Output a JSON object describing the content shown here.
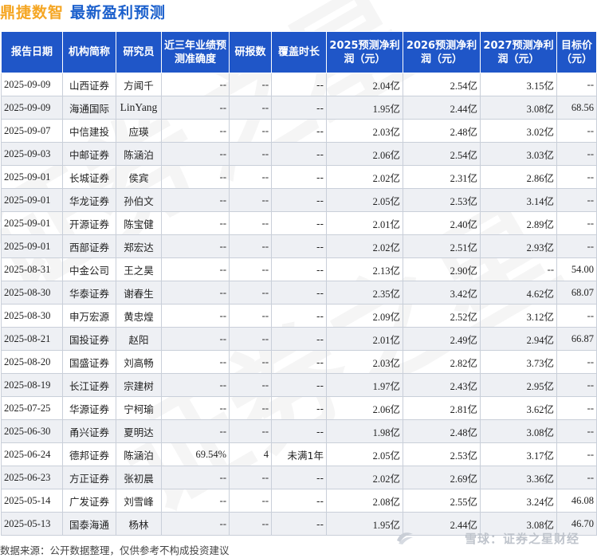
{
  "header": {
    "brand": "鼎捷数智",
    "title": "最新盈利预测"
  },
  "table": {
    "columns": [
      "报告日期",
      "机构简称",
      "研究员",
      "近三年业绩预测准确度",
      "研报数",
      "覆盖时长",
      "2025预测净利润（元）",
      "2026预测净利润（元）",
      "2027预测净利润（元）",
      "目标价（元）"
    ],
    "rows": [
      [
        "2025-09-09",
        "山西证券",
        "方闻千",
        "--",
        "--",
        "--",
        "2.04亿",
        "2.54亿",
        "3.15亿",
        "--"
      ],
      [
        "2025-09-09",
        "海通国际",
        "LinYang",
        "--",
        "--",
        "--",
        "1.95亿",
        "2.44亿",
        "3.08亿",
        "68.56"
      ],
      [
        "2025-09-07",
        "中信建投",
        "应瑛",
        "--",
        "--",
        "--",
        "2.03亿",
        "2.48亿",
        "3.02亿",
        "--"
      ],
      [
        "2025-09-03",
        "中邮证券",
        "陈涵泊",
        "--",
        "--",
        "--",
        "2.06亿",
        "2.54亿",
        "3.03亿",
        "--"
      ],
      [
        "2025-09-01",
        "长城证券",
        "侯宾",
        "--",
        "--",
        "--",
        "2.02亿",
        "2.31亿",
        "2.86亿",
        "--"
      ],
      [
        "2025-09-01",
        "华龙证券",
        "孙伯文",
        "--",
        "--",
        "--",
        "2.05亿",
        "2.53亿",
        "3.14亿",
        "--"
      ],
      [
        "2025-09-01",
        "开源证券",
        "陈宝健",
        "--",
        "--",
        "--",
        "2.01亿",
        "2.40亿",
        "2.89亿",
        "--"
      ],
      [
        "2025-09-01",
        "西部证券",
        "郑宏达",
        "--",
        "--",
        "--",
        "2.02亿",
        "2.51亿",
        "2.93亿",
        "--"
      ],
      [
        "2025-08-31",
        "中金公司",
        "王之昊",
        "--",
        "--",
        "--",
        "2.13亿",
        "2.90亿",
        "--",
        "54.00"
      ],
      [
        "2025-08-30",
        "华泰证券",
        "谢春生",
        "--",
        "--",
        "--",
        "2.35亿",
        "3.42亿",
        "4.62亿",
        "68.07"
      ],
      [
        "2025-08-30",
        "申万宏源",
        "黄忠煌",
        "--",
        "--",
        "--",
        "2.09亿",
        "2.52亿",
        "3.12亿",
        "--"
      ],
      [
        "2025-08-21",
        "国投证券",
        "赵阳",
        "--",
        "--",
        "--",
        "2.01亿",
        "2.49亿",
        "2.94亿",
        "66.87"
      ],
      [
        "2025-08-20",
        "国盛证券",
        "刘高畅",
        "--",
        "--",
        "--",
        "2.03亿",
        "2.82亿",
        "3.73亿",
        "--"
      ],
      [
        "2025-08-19",
        "长江证券",
        "宗建树",
        "--",
        "--",
        "--",
        "1.97亿",
        "2.43亿",
        "2.95亿",
        "--"
      ],
      [
        "2025-07-25",
        "华源证券",
        "宁柯瑜",
        "--",
        "--",
        "--",
        "2.06亿",
        "2.81亿",
        "3.62亿",
        "--"
      ],
      [
        "2025-06-30",
        "甬兴证券",
        "夏明达",
        "--",
        "--",
        "--",
        "1.98亿",
        "2.48亿",
        "3.08亿",
        "--"
      ],
      [
        "2025-06-24",
        "德邦证券",
        "陈涵泊",
        "69.54%",
        "4",
        "未满1年",
        "2.05亿",
        "2.53亿",
        "3.17亿",
        "--"
      ],
      [
        "2025-06-23",
        "方正证券",
        "张初晨",
        "--",
        "--",
        "--",
        "2.02亿",
        "2.69亿",
        "3.36亿",
        "--"
      ],
      [
        "2025-05-14",
        "广发证券",
        "刘雪峰",
        "--",
        "--",
        "--",
        "2.08亿",
        "2.55亿",
        "3.24亿",
        "46.08"
      ],
      [
        "2025-05-13",
        "国泰海通",
        "杨林",
        "--",
        "--",
        "--",
        "1.95亿",
        "2.44亿",
        "3.08亿",
        "46.70"
      ]
    ]
  },
  "footer": {
    "source": "数据来源：公开数据整理，仅供参考不构成投资建议"
  },
  "watermark": {
    "text": "雪球：证券之星财经",
    "icon": "snowball-logo-icon",
    "bg_text": "证券之星"
  },
  "colors": {
    "header_bg": "#1f56c8",
    "brand": "#f5a623",
    "title": "#1a5fcc",
    "profit": "#e0001b",
    "stripe": "#eef0f4"
  }
}
